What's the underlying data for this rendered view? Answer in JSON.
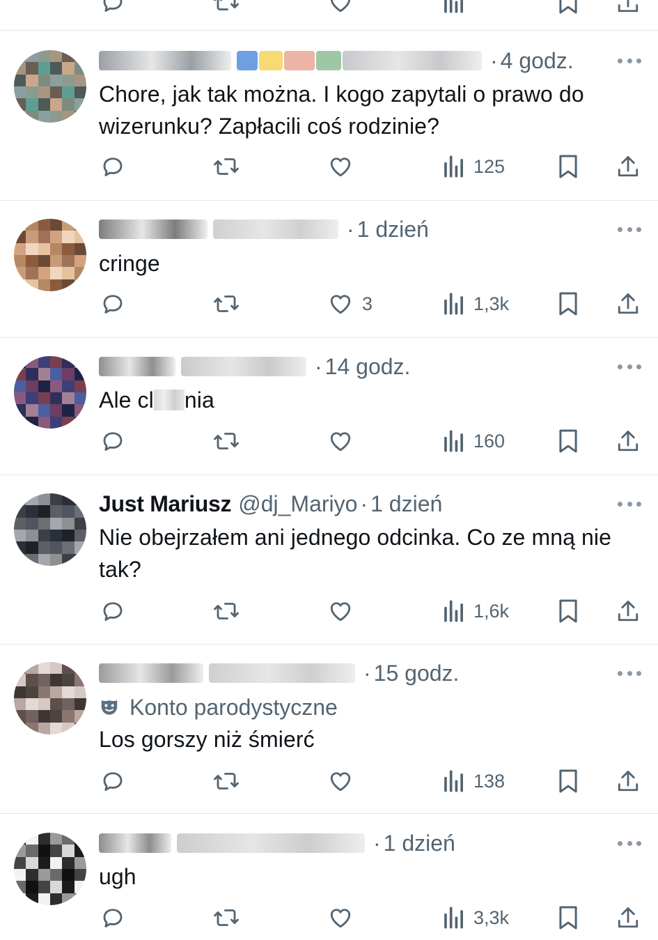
{
  "replies": [
    {
      "name": "",
      "handle": "",
      "time": "4 godz.",
      "text": "Chore, jak tak można. I kogo zapytali o prawo do wizerunku? Zapłacili coś rodzinie?",
      "label": "",
      "stats": {
        "reply": "",
        "retweet": "",
        "like": "",
        "views": "125"
      }
    },
    {
      "name": "",
      "handle": "",
      "time": "1 dzień",
      "text": "cringe",
      "label": "",
      "stats": {
        "reply": "",
        "retweet": "",
        "like": "3",
        "views": "1,3k"
      }
    },
    {
      "name": "",
      "handle": "",
      "time": "14 godz.",
      "text_start": "Ale cl",
      "text_end": "nia",
      "label": "",
      "stats": {
        "reply": "",
        "retweet": "",
        "like": "",
        "views": "160"
      }
    },
    {
      "name": "Just Mariusz",
      "handle": "@dj_Mariyo",
      "time": "1 dzień",
      "text": "Nie obejrzałem ani jednego odcinka. Co ze mną nie tak?",
      "label": "",
      "stats": {
        "reply": "",
        "retweet": "",
        "like": "",
        "views": "1,6k"
      }
    },
    {
      "name": "",
      "handle": "",
      "time": "15 godz.",
      "label": "Konto parodystyczne",
      "text": "Los gorszy niż śmierć",
      "stats": {
        "reply": "",
        "retweet": "",
        "like": "",
        "views": "138"
      }
    },
    {
      "name": "",
      "handle": "",
      "time": "1 dzień",
      "text": "ugh",
      "label": "",
      "stats": {
        "reply": "",
        "retweet": "",
        "like": "",
        "views": "3,3k"
      }
    }
  ],
  "dot_separator": "·",
  "icons": [
    "reply-icon",
    "retweet-icon",
    "like-icon",
    "views-icon",
    "bookmark-icon",
    "share-icon",
    "more-icon",
    "parody-mask-icon"
  ],
  "colors": {
    "text": "#0f1419",
    "secondary": "#536471",
    "divider": "#e4e8eb",
    "parody": "#5b7083"
  }
}
